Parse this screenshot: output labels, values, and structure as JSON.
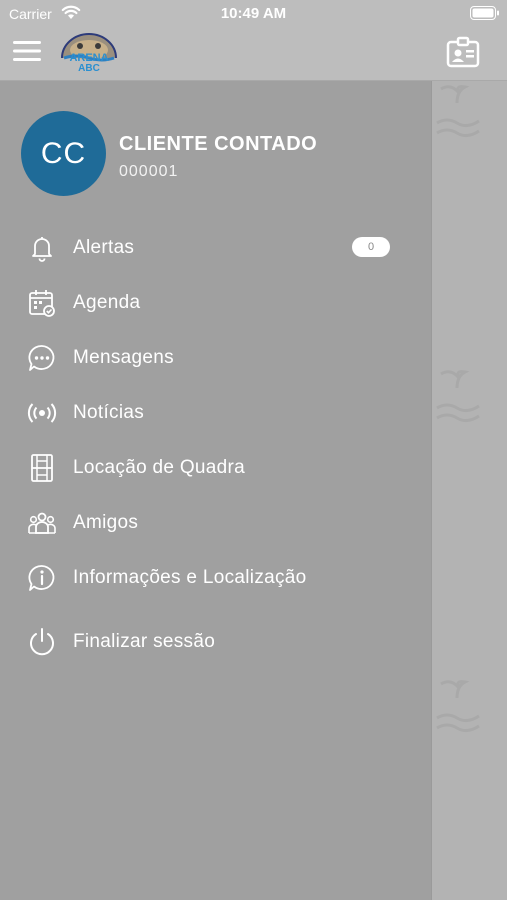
{
  "status_bar": {
    "carrier": "Carrier",
    "time": "10:49 AM"
  },
  "header": {
    "logo_text_line1": "ARENA",
    "logo_text_line2": "ABC",
    "icons": [
      "menu-icon",
      "logo",
      "badge-icon"
    ]
  },
  "profile": {
    "initials": "CC",
    "name": "CLIENTE CONTADO",
    "code": "000001",
    "avatar_color": "#1f6b98"
  },
  "menu": {
    "items": [
      {
        "label": "Alertas",
        "icon": "bell-icon",
        "count": "0"
      },
      {
        "label": "Agenda",
        "icon": "calendar-check-icon"
      },
      {
        "label": "Mensagens",
        "icon": "chat-bubble-icon"
      },
      {
        "label": "Notícias",
        "icon": "broadcast-icon"
      },
      {
        "label": "Locação de Quadra",
        "icon": "court-icon"
      },
      {
        "label": "Amigos",
        "icon": "group-icon"
      },
      {
        "label": "Informações e Localização",
        "icon": "info-bubble-icon"
      },
      {
        "label": "Finalizar sessão",
        "icon": "power-icon"
      }
    ]
  },
  "colors": {
    "drawer_bg": "#a0a0a0",
    "header_bg": "#bdbdbd",
    "accent": "#1f6b98"
  }
}
